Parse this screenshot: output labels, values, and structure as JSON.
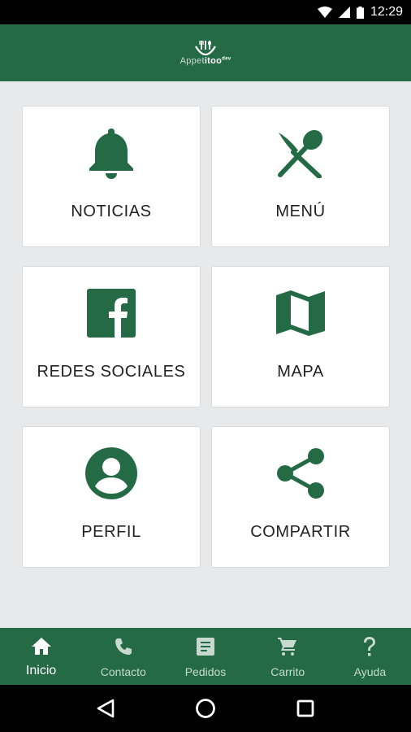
{
  "status_bar": {
    "time": "12:29"
  },
  "app_bar": {
    "logo_light": "Appet",
    "logo_bold": "itoo",
    "logo_sup": "dev"
  },
  "tiles": [
    {
      "label": "NOTICIAS",
      "icon": "bell-icon"
    },
    {
      "label": "MENÚ",
      "icon": "fork-spoon-icon"
    },
    {
      "label": "REDES SOCIALES",
      "icon": "facebook-icon"
    },
    {
      "label": "MAPA",
      "icon": "map-icon"
    },
    {
      "label": "PERFIL",
      "icon": "profile-icon"
    },
    {
      "label": "COMPARTIR",
      "icon": "share-icon"
    }
  ],
  "bottom_nav": [
    {
      "label": "Inicio",
      "icon": "home-icon",
      "active": true
    },
    {
      "label": "Contacto",
      "icon": "phone-icon"
    },
    {
      "label": "Pedidos",
      "icon": "list-icon"
    },
    {
      "label": "Carrito",
      "icon": "cart-icon"
    },
    {
      "label": "Ayuda",
      "icon": "help-icon"
    }
  ],
  "colors": {
    "primary": "#246b45",
    "background": "#e8e9eb",
    "tile": "#ffffff"
  }
}
